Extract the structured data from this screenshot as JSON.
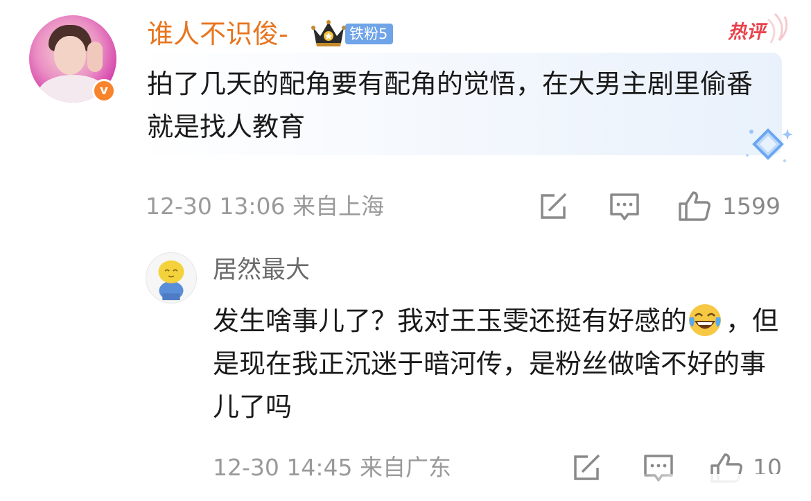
{
  "main_comment": {
    "username": "谁人不识俊-",
    "fan_badge": "铁粉5",
    "hot_tag": "热评",
    "text": "拍了几天的配角要有配角的觉悟，在大男主剧里偷番就是找人教育",
    "time": "12-30 13:06",
    "location": "来自上海",
    "likes": "1599",
    "icons": {
      "verified": "verified-v-icon",
      "crown": "crown-icon",
      "share": "share-icon",
      "comment": "comment-icon",
      "like": "thumbs-up-icon"
    },
    "verified_mark": "v",
    "colors": {
      "username": "#e8751f",
      "badge": "#6fa4e8",
      "hot": "#e8434d",
      "verified": "#f7842c"
    }
  },
  "reply": {
    "username": "居然最大",
    "text_before_emoji": "发生啥事儿了？我对王玉雯还挺有好感的",
    "emoji": "laughing-crying-emoji",
    "text_after_emoji": "，但是现在我正沉迷于暗河传，是粉丝做啥不好的事儿了吗",
    "time": "12-30 14:45",
    "location": "来自广东",
    "likes": "10"
  }
}
